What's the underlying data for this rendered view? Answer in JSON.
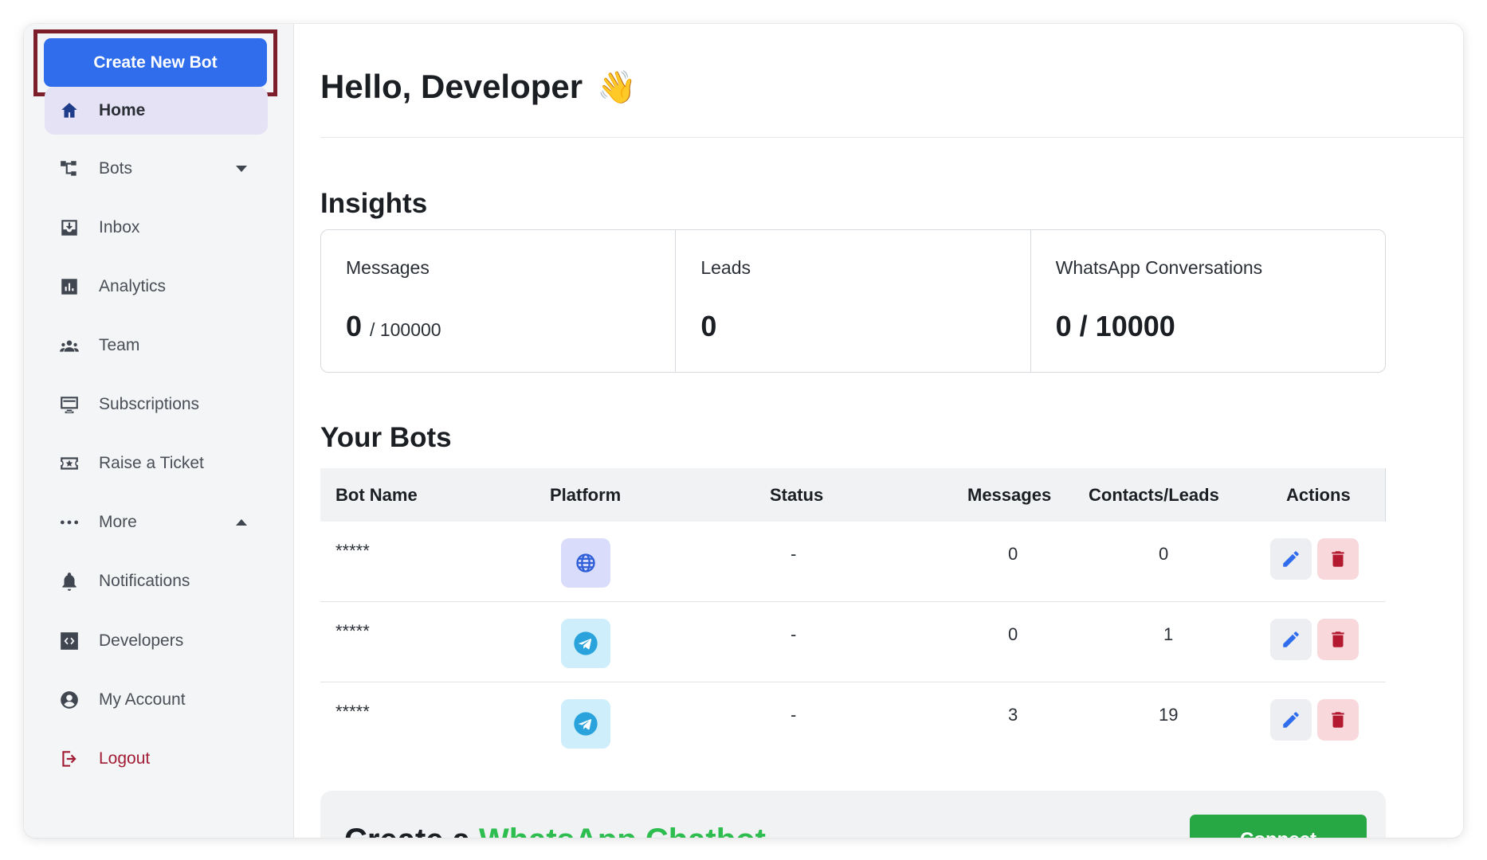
{
  "sidebar": {
    "create_button": "Create New Bot",
    "items": [
      {
        "label": "Home",
        "icon": "home-icon"
      },
      {
        "label": "Bots",
        "icon": "bots-icon"
      },
      {
        "label": "Inbox",
        "icon": "inbox-icon"
      },
      {
        "label": "Analytics",
        "icon": "analytics-icon"
      },
      {
        "label": "Team",
        "icon": "team-icon"
      },
      {
        "label": "Subscriptions",
        "icon": "subscriptions-icon"
      },
      {
        "label": "Raise a Ticket",
        "icon": "ticket-icon"
      },
      {
        "label": "More",
        "icon": "more-icon"
      },
      {
        "label": "Notifications",
        "icon": "bell-icon"
      },
      {
        "label": "Developers",
        "icon": "code-icon"
      },
      {
        "label": "My Account",
        "icon": "account-icon"
      },
      {
        "label": "Logout",
        "icon": "logout-icon"
      }
    ]
  },
  "main": {
    "greeting": "Hello, Developer",
    "greeting_emoji": "👋",
    "insights_title": "Insights",
    "insights": [
      {
        "label": "Messages",
        "value": "0",
        "suffix": "/ 100000"
      },
      {
        "label": "Leads",
        "value": "0",
        "suffix": ""
      },
      {
        "label": "WhatsApp Conversations",
        "value": "0 / 10000",
        "suffix": ""
      }
    ],
    "bots_title": "Your Bots",
    "table": {
      "headers": [
        "Bot Name",
        "Platform",
        "Status",
        "Messages",
        "Contacts/Leads",
        "Actions"
      ],
      "rows": [
        {
          "name": "*****",
          "platform": "web",
          "status": "-",
          "messages": "0",
          "contacts": "0"
        },
        {
          "name": "*****",
          "platform": "telegram",
          "status": "-",
          "messages": "0",
          "contacts": "1"
        },
        {
          "name": "*****",
          "platform": "telegram",
          "status": "-",
          "messages": "3",
          "contacts": "19"
        }
      ]
    },
    "whatsapp_card": {
      "title_prefix": "Create a ",
      "title_highlight": "WhatsApp Chatbot",
      "button": "Connect"
    }
  },
  "colors": {
    "primary": "#2f6ded",
    "active_bg": "#e6e2f5",
    "danger": "#a31c35",
    "whatsapp_green": "#2ebd4f",
    "highlight_border": "#7d1e2b"
  }
}
